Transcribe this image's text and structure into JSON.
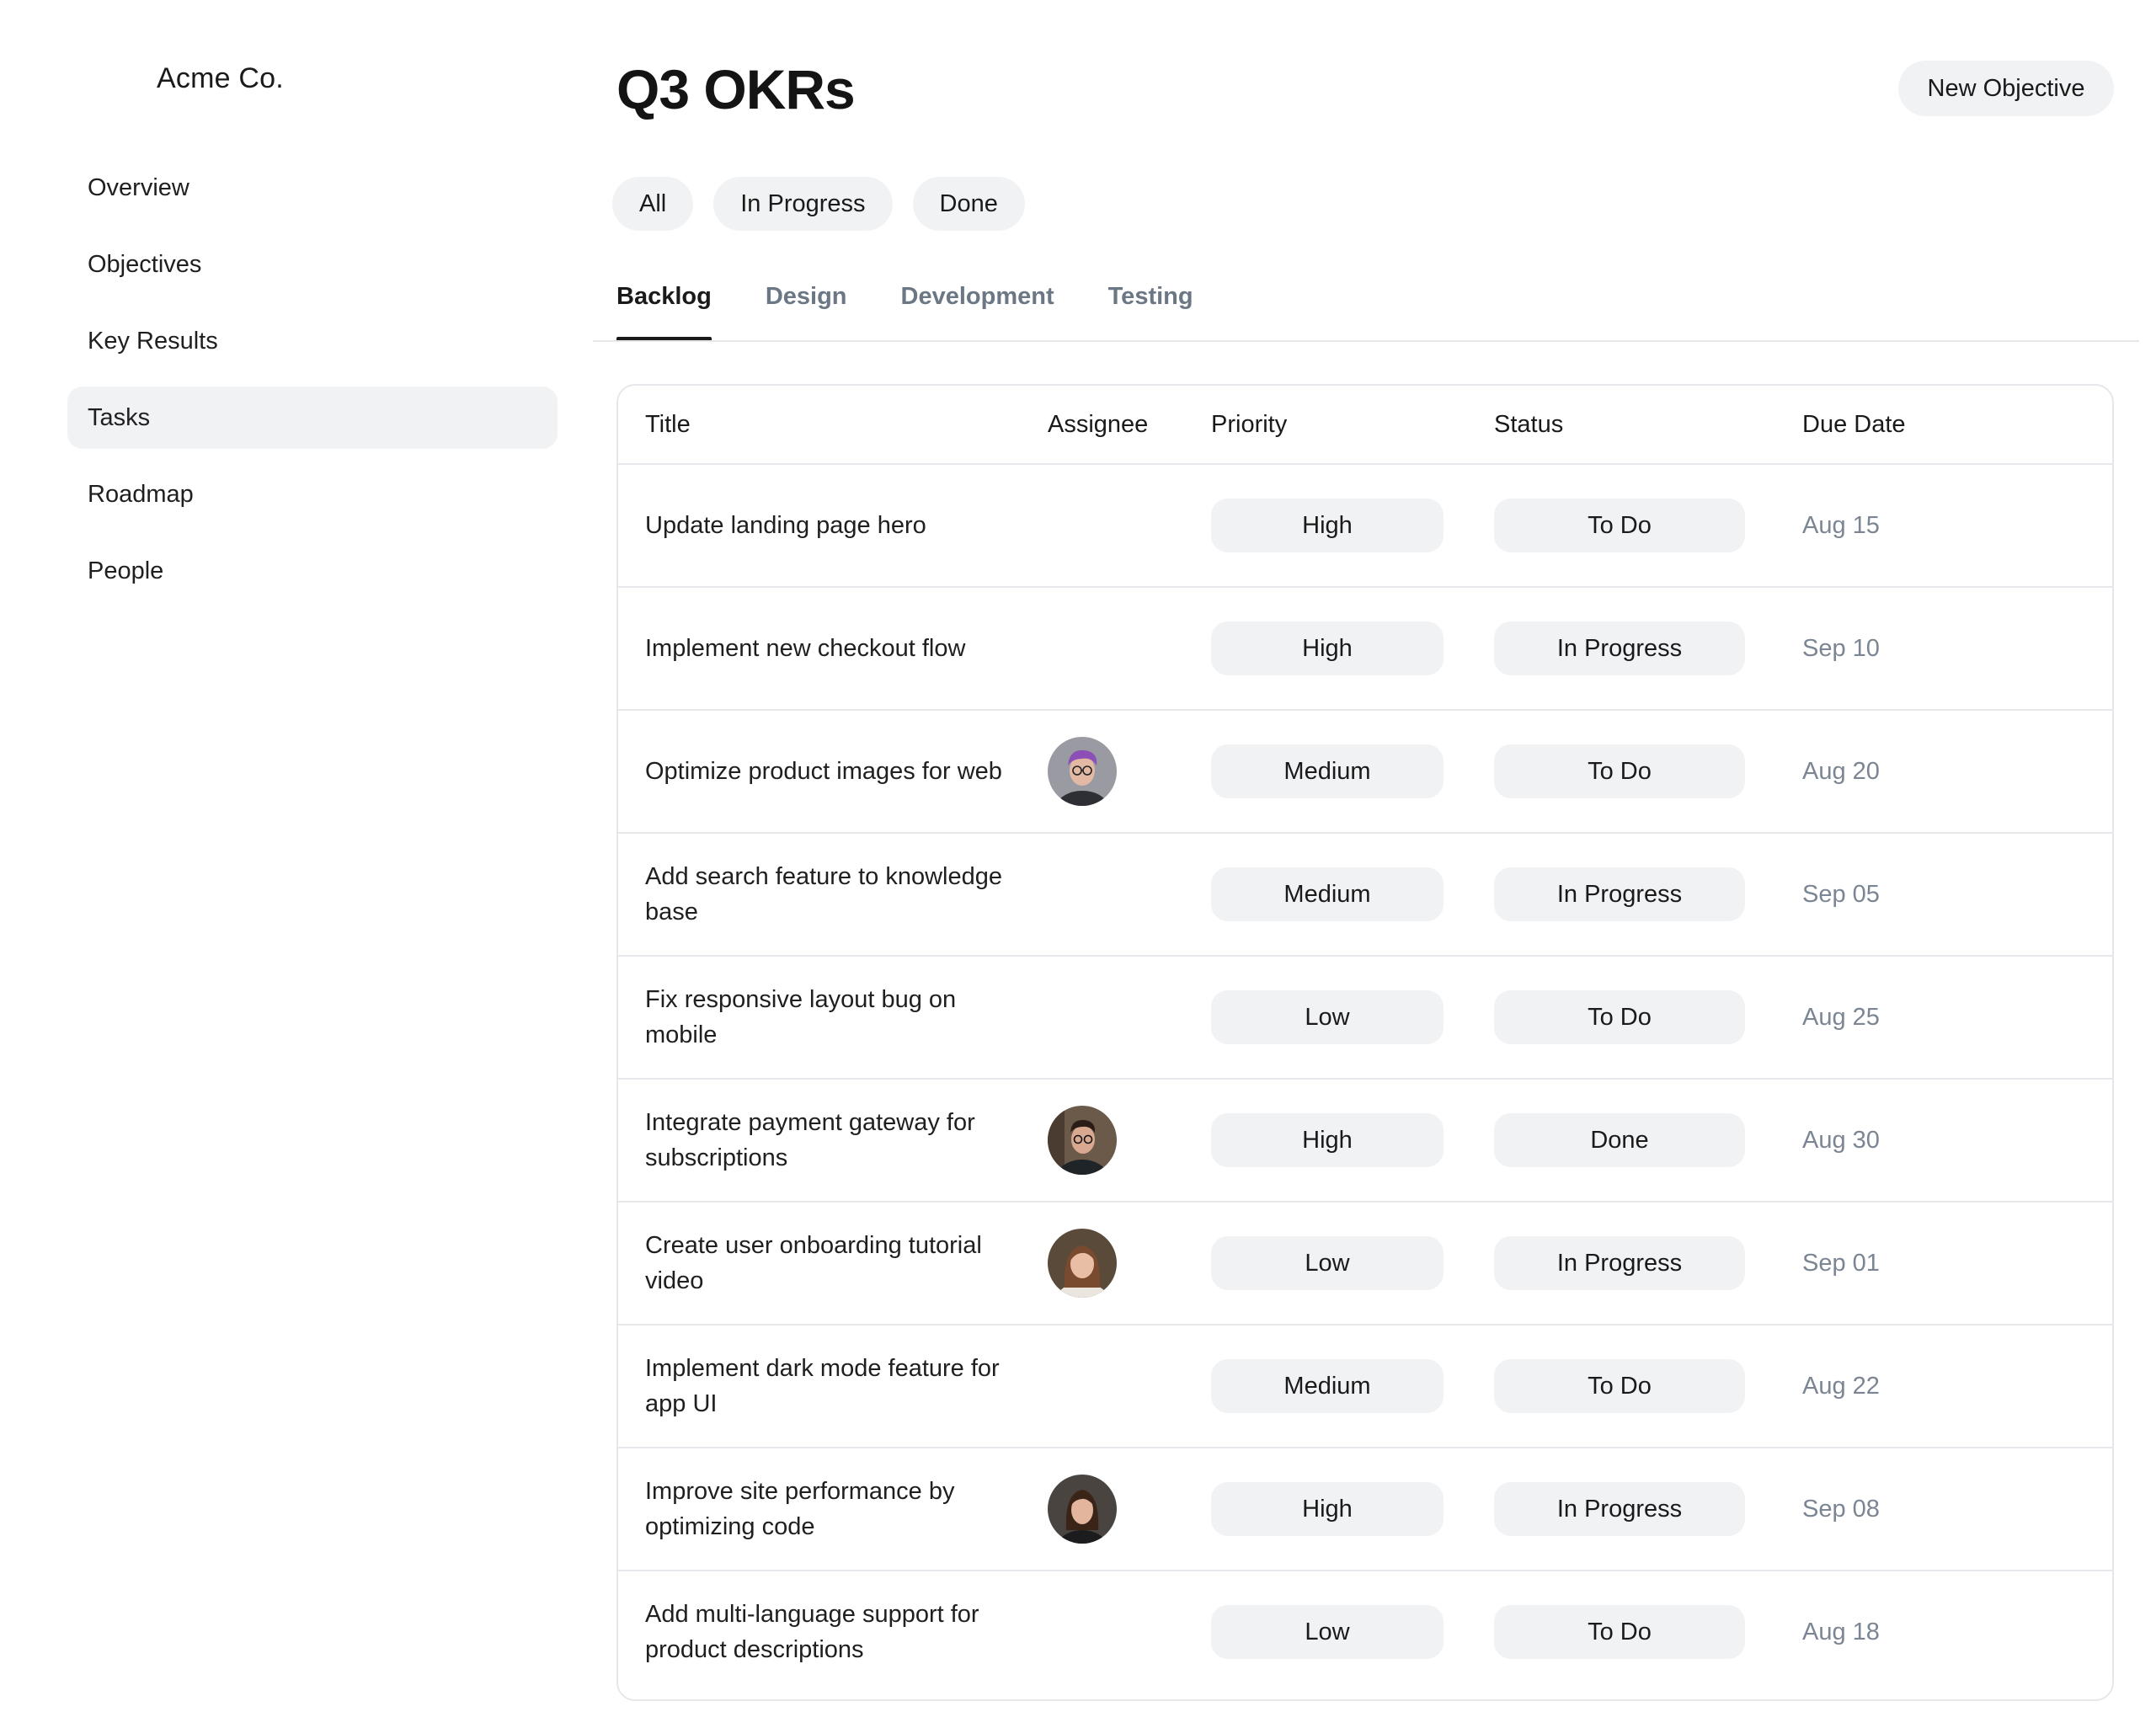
{
  "sidebar": {
    "brand": "Acme Co.",
    "items": [
      {
        "label": "Overview"
      },
      {
        "label": "Objectives"
      },
      {
        "label": "Key Results"
      },
      {
        "label": "Tasks",
        "active": true
      },
      {
        "label": "Roadmap"
      },
      {
        "label": "People"
      }
    ]
  },
  "header": {
    "title": "Q3 OKRs",
    "new_button": "New Objective"
  },
  "filters": [
    "All",
    "In Progress",
    "Done"
  ],
  "tabs": [
    {
      "label": "Backlog",
      "active": true
    },
    {
      "label": "Design"
    },
    {
      "label": "Development"
    },
    {
      "label": "Testing"
    }
  ],
  "table": {
    "columns": [
      "Title",
      "Assignee",
      "Priority",
      "Status",
      "Due Date"
    ],
    "rows": [
      {
        "title": "Update landing page hero",
        "assignee": null,
        "priority": "High",
        "status": "To Do",
        "due": "Aug 15"
      },
      {
        "title": "Implement new checkout flow",
        "assignee": null,
        "priority": "High",
        "status": "In Progress",
        "due": "Sep 10"
      },
      {
        "title": "Optimize product images for web",
        "assignee": "avatar-1",
        "priority": "Medium",
        "status": "To Do",
        "due": "Aug 20"
      },
      {
        "title": "Add search feature to knowledge base",
        "assignee": null,
        "priority": "Medium",
        "status": "In Progress",
        "due": "Sep 05"
      },
      {
        "title": "Fix responsive layout bug on mobile",
        "assignee": null,
        "priority": "Low",
        "status": "To Do",
        "due": "Aug 25"
      },
      {
        "title": "Integrate payment gateway for subscriptions",
        "assignee": "avatar-2",
        "priority": "High",
        "status": "Done",
        "due": "Aug 30"
      },
      {
        "title": "Create user onboarding tutorial video",
        "assignee": "avatar-3",
        "priority": "Low",
        "status": "In Progress",
        "due": "Sep 01"
      },
      {
        "title": "Implement dark mode feature for app UI",
        "assignee": null,
        "priority": "Medium",
        "status": "To Do",
        "due": "Aug 22"
      },
      {
        "title": "Improve site performance by optimizing code",
        "assignee": "avatar-4",
        "priority": "High",
        "status": "In Progress",
        "due": "Sep 08"
      },
      {
        "title": "Add multi-language support for product descriptions",
        "assignee": null,
        "priority": "Low",
        "status": "To Do",
        "due": "Aug 18"
      }
    ]
  },
  "colors": {
    "pill_bg": "#f1f2f4",
    "border": "#e5e7eb",
    "muted_text": "#7b8593",
    "tab_inactive": "#6b7785"
  }
}
